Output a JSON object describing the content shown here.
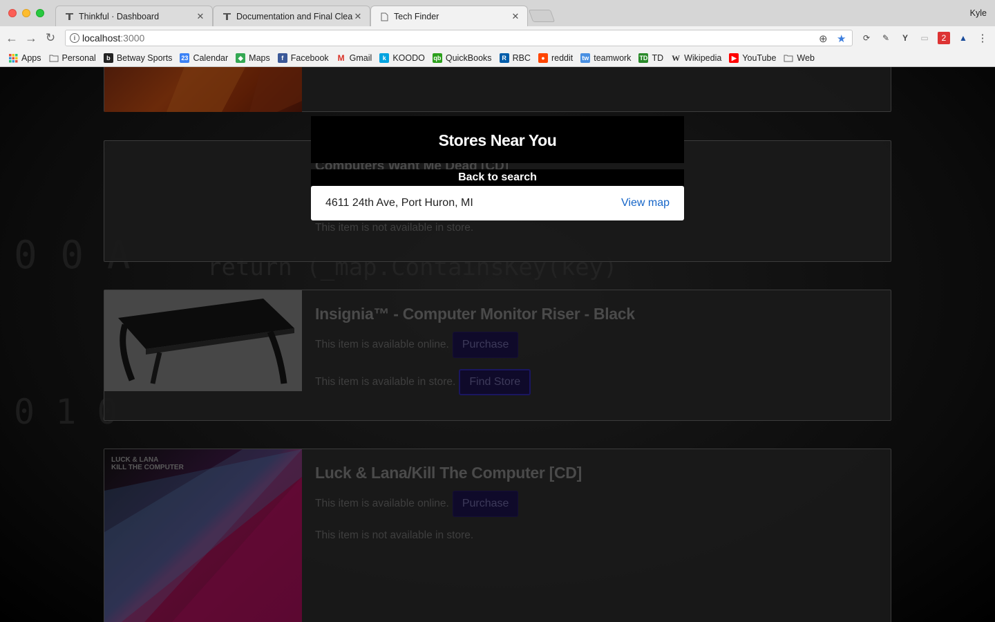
{
  "browser": {
    "tabs": [
      {
        "title": "Thinkful · Dashboard",
        "icon": "thinkful-icon",
        "active": false
      },
      {
        "title": "Documentation and Final Clean",
        "icon": "thinkful-icon",
        "active": false
      },
      {
        "title": "Tech Finder",
        "icon": "page-icon",
        "active": true
      }
    ],
    "profile_name": "Kyle",
    "address": {
      "host": "localhost",
      "port": ":3000"
    },
    "bookmarks": [
      {
        "label": "Apps",
        "icon": "apps-grid-icon",
        "color": "#e74c3c"
      },
      {
        "label": "Personal",
        "icon": "folder-icon",
        "color": "#888888"
      },
      {
        "label": "Betway Sports",
        "icon": "betway-icon",
        "color": "#222222"
      },
      {
        "label": "Calendar",
        "icon": "calendar-icon",
        "color": "#3b82f6"
      },
      {
        "label": "Maps",
        "icon": "maps-icon",
        "color": "#34a853"
      },
      {
        "label": "Facebook",
        "icon": "facebook-icon",
        "color": "#3b5998"
      },
      {
        "label": "Gmail",
        "icon": "gmail-icon",
        "color": "#d93025"
      },
      {
        "label": "KOODO",
        "icon": "koodo-icon",
        "color": "#00a3e0"
      },
      {
        "label": "QuickBooks",
        "icon": "quickbooks-icon",
        "color": "#2ca01c"
      },
      {
        "label": "RBC",
        "icon": "rbc-icon",
        "color": "#005daa"
      },
      {
        "label": "reddit",
        "icon": "reddit-icon",
        "color": "#ff4500"
      },
      {
        "label": "teamwork",
        "icon": "teamwork-icon",
        "color": "#4a90e2"
      },
      {
        "label": "TD",
        "icon": "td-icon",
        "color": "#2a8a2a"
      },
      {
        "label": "Wikipedia",
        "icon": "wikipedia-icon",
        "color": "#555555"
      },
      {
        "label": "YouTube",
        "icon": "youtube-icon",
        "color": "#ff0000"
      },
      {
        "label": "Web",
        "icon": "folder-icon",
        "color": "#888888"
      }
    ]
  },
  "modal": {
    "title": "Stores Near You",
    "ghost_title": "Computers Want Me Dead [CD]",
    "back_label": "Back to search",
    "stores": [
      {
        "address": "4611 24th Ave, Port Huron, MI",
        "link_label": "View map"
      }
    ]
  },
  "products": [
    {
      "title": "Computers Want Me Dead [CD]",
      "not_in_store": "This item is not available in store."
    },
    {
      "title": "Insignia™ - Computer Monitor Riser - Black",
      "online_text": "This item is available online.",
      "purchase_label": "Purchase",
      "store_text": "This item is available in store.",
      "find_store_label": "Find Store"
    },
    {
      "title": "Luck & Lana/Kill The Computer [CD]",
      "album_text_1": "LUCK & LANA",
      "album_text_2": "KILL THE COMPUTER",
      "online_text": "This item is available online.",
      "purchase_label": "Purchase",
      "not_in_store": "This item is not available in store."
    }
  ],
  "colors": {
    "link": "#1565c8",
    "button_bg": "#0f0a2a"
  }
}
